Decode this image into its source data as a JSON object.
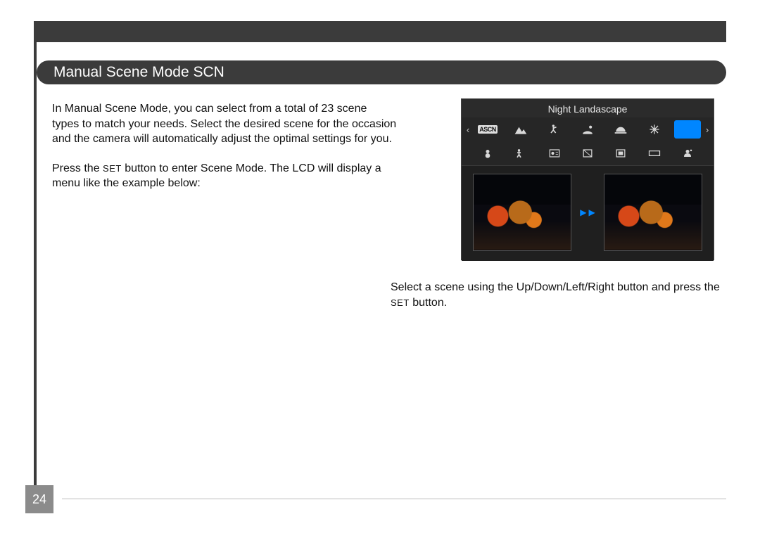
{
  "page": {
    "number": "24"
  },
  "heading": "Manual Scene Mode SCN",
  "left": {
    "p1": "In Manual Scene Mode, you can select from a total of 23 scene types to match your needs. Select the desired scene for the occasion and the camera will automatically adjust the optimal settings for you.",
    "p2a": "Press the ",
    "p2set": "SET",
    "p2b": " button to enter Scene Mode. The LCD will display a menu like the example below:"
  },
  "right": {
    "p1a": "Select a scene using the Up/Down/Left/Right button and press the ",
    "p1set": "SET",
    "p1b": " button."
  },
  "lcd": {
    "title": "Night Landascape",
    "row1": [
      "ASCN",
      "landscape",
      "sport",
      "beach",
      "sunset",
      "fireworks",
      "night-landscape"
    ],
    "row2": [
      "snow",
      "children",
      "id-photo",
      "glass",
      "museum",
      "panorama",
      "night-portrait"
    ],
    "selected": "night-landscape"
  }
}
